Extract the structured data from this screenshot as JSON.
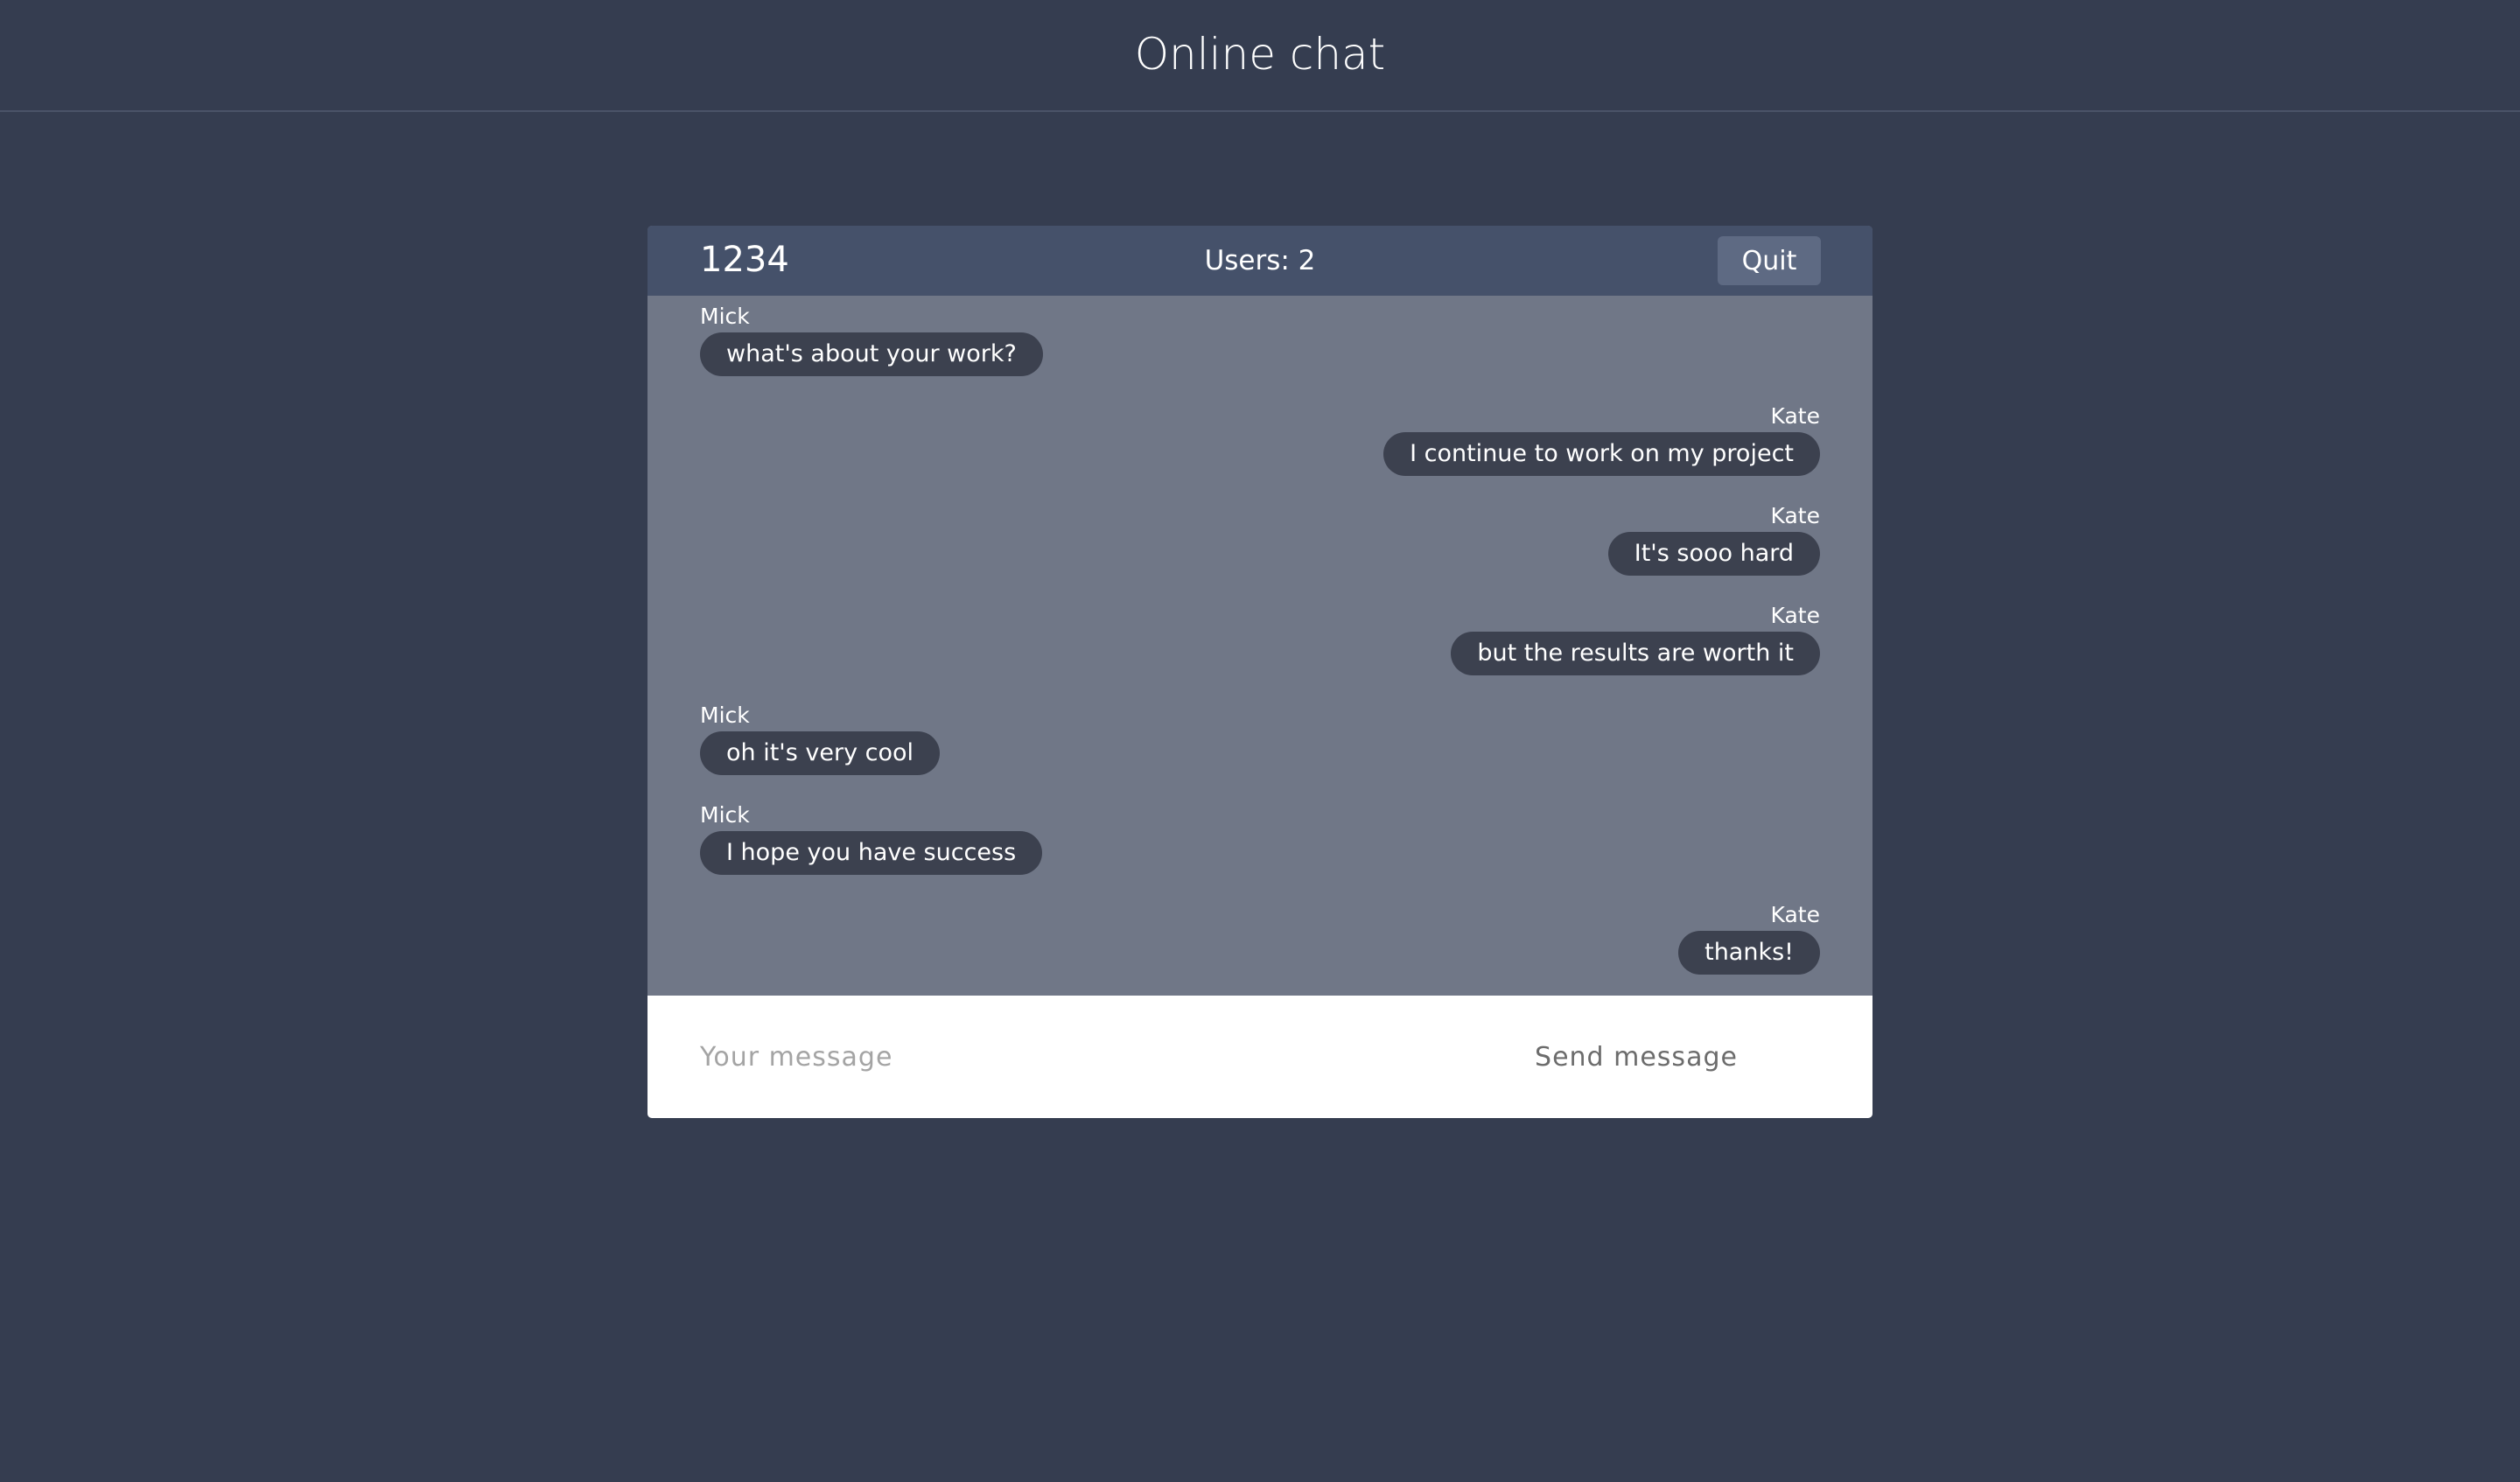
{
  "page": {
    "title": "Online chat"
  },
  "chat": {
    "room_id": "1234",
    "users_label": "Users: 2",
    "quit_label": "Quit",
    "messages": [
      {
        "author": "Mick",
        "text": "what's about your work?",
        "side": "theirs"
      },
      {
        "author": "Kate",
        "text": "I continue to work on my project",
        "side": "mine"
      },
      {
        "author": "Kate",
        "text": "It's sooo hard",
        "side": "mine"
      },
      {
        "author": "Kate",
        "text": "but the results are worth it",
        "side": "mine"
      },
      {
        "author": "Mick",
        "text": "oh it's very cool",
        "side": "theirs"
      },
      {
        "author": "Mick",
        "text": "I hope you have success",
        "side": "theirs"
      },
      {
        "author": "Kate",
        "text": "thanks!",
        "side": "mine"
      }
    ]
  },
  "composer": {
    "placeholder": "Your message",
    "value": "",
    "send_label": "Send message"
  },
  "colors": {
    "background": "#353d50",
    "header": "#45516a",
    "messages_area": "#707787",
    "bubble": "#3c414f",
    "quit_button": "#5e6a83"
  }
}
